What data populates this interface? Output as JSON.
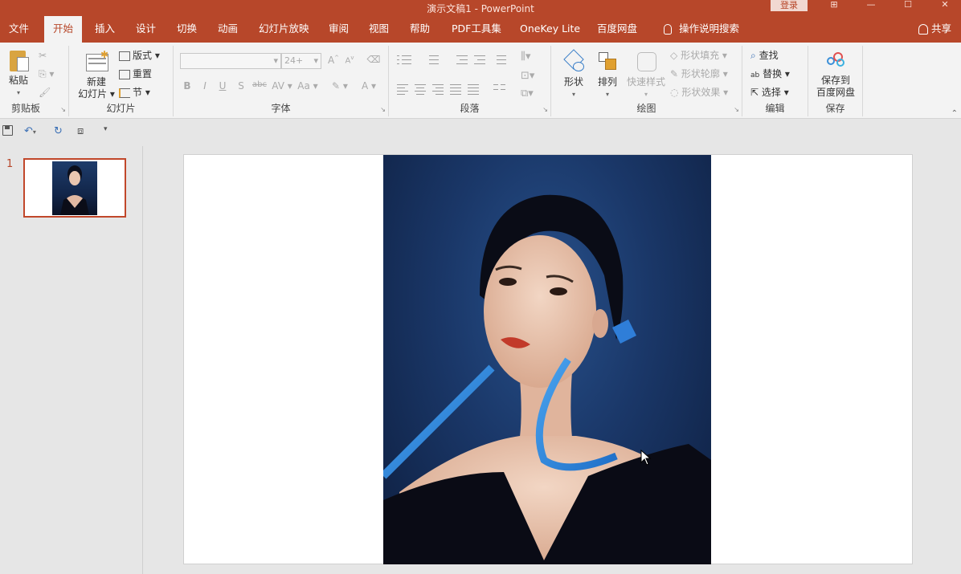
{
  "titlebar": {
    "title": "演示文稿1 - PowerPoint",
    "login": "登录"
  },
  "tabs": [
    "文件",
    "开始",
    "插入",
    "设计",
    "切换",
    "动画",
    "幻灯片放映",
    "审阅",
    "视图",
    "帮助",
    "PDF工具集",
    "OneKey Lite",
    "百度网盘",
    "操作说明搜索"
  ],
  "share": "共享",
  "ribbon": {
    "clipboard": {
      "label": "剪贴板",
      "paste": "粘贴"
    },
    "slides": {
      "label": "幻灯片",
      "new_slide_1": "新建",
      "new_slide_2": "幻灯片",
      "layout": "版式",
      "reset": "重置",
      "section": "节"
    },
    "font": {
      "label": "字体",
      "size": "24+",
      "bold": "B",
      "italic": "I",
      "underline": "U",
      "shadow": "S",
      "strike": "abc",
      "spacing": "AV",
      "case": "Aa",
      "color": "A",
      "grow": "A",
      "shrink": "A"
    },
    "paragraph": {
      "label": "段落"
    },
    "drawing": {
      "label": "绘图",
      "shapes": "形状",
      "arrange": "排列",
      "quick_styles": "快速样式",
      "fill": "形状填充",
      "outline": "形状轮廓",
      "effects": "形状效果"
    },
    "editing": {
      "label": "编辑",
      "find": "查找",
      "replace": "替换",
      "select": "选择"
    },
    "save": {
      "label": "保存",
      "save_1": "保存到",
      "save_2": "百度网盘"
    }
  },
  "slides_pane": {
    "number": "1"
  },
  "colors": {
    "accent": "#b7472a",
    "ribbon": "#f3f3f3",
    "slide_bg": "#ffffff"
  }
}
